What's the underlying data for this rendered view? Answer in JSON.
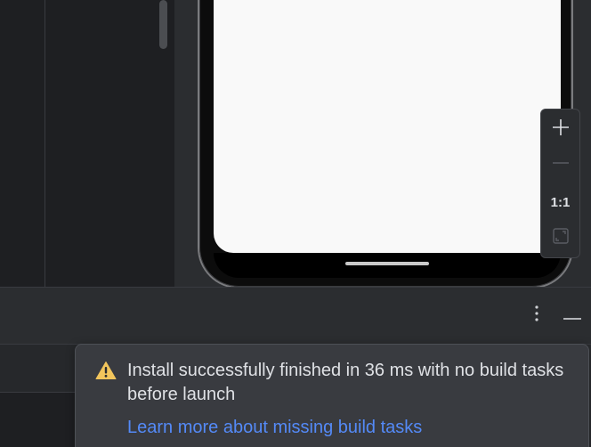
{
  "zoom_toolbar": {
    "zoom_in_icon": "plus-icon",
    "zoom_out_icon": "minus-icon",
    "actual_size_label": "1:1",
    "fit_screen_icon": "fit-screen-icon"
  },
  "tool_window": {
    "options_icon": "kebab-icon",
    "minimize_icon": "minimize-icon"
  },
  "notification": {
    "type": "warning",
    "icon": "warning-icon",
    "message": "Install successfully finished in 36 ms with no build tasks before launch",
    "link_text": "Learn more about missing build tasks"
  },
  "colors": {
    "warning": "#f2c55c",
    "link": "#548af7",
    "background": "#2b2d30"
  }
}
